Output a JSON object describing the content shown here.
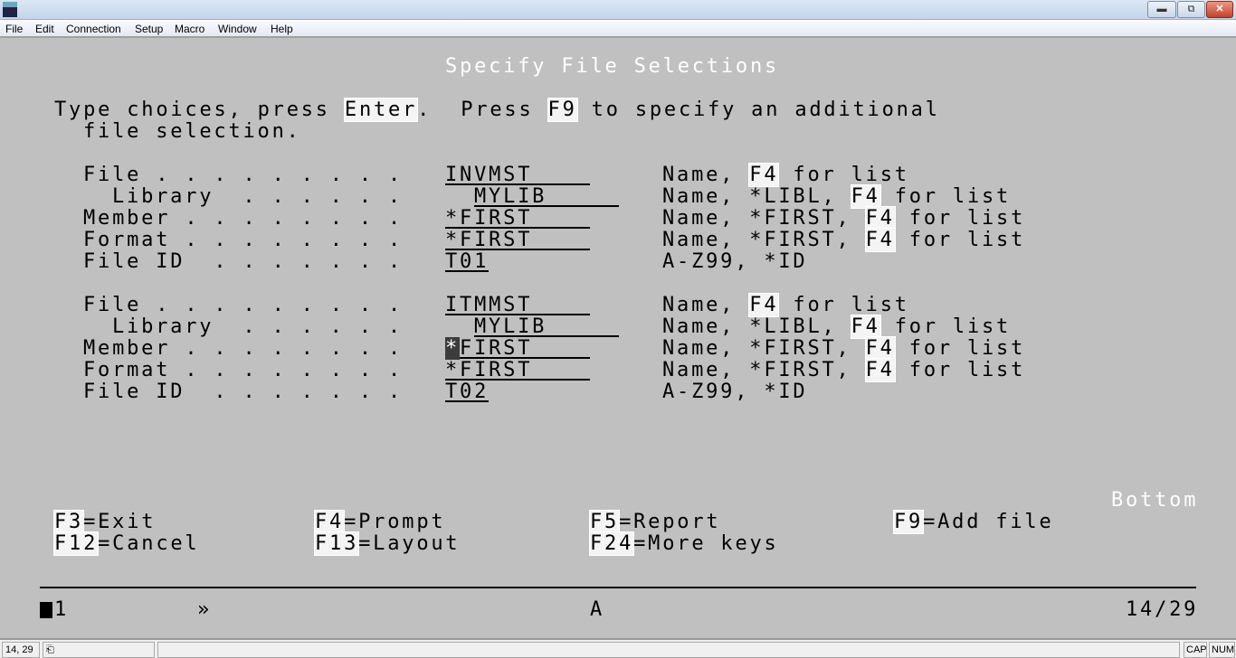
{
  "window": {
    "app_icon": "IBM",
    "controls": [
      "minimize",
      "restore",
      "close"
    ]
  },
  "menu": [
    "File",
    "Edit",
    "Connection",
    "Setup",
    "Macro",
    "Window",
    "Help"
  ],
  "screen": {
    "title": "Specify File Selections",
    "instructions": {
      "p1": "Type choices, press ",
      "k1": "Enter",
      "p2": ".  Press ",
      "k2": "F9",
      "p3": " to specify an additional",
      "line2": "file selection."
    },
    "groups": [
      {
        "file": "INVMST",
        "library": "MYLIB",
        "member": "*FIRST",
        "format": "*FIRST",
        "file_id": "T01"
      },
      {
        "file": "ITMMST",
        "library": "MYLIB",
        "member_cursor": "*",
        "member_rest": "FIRST",
        "format": "*FIRST",
        "file_id": "T02"
      }
    ],
    "labels": {
      "file": "File . . . . . . . . .",
      "library": "Library  . . . . . .",
      "member": "Member . . . . . . . .",
      "format": "Format . . . . . . . .",
      "file_id": "File ID  . . . . . . ."
    },
    "help": {
      "name": "Name, ",
      "name_lib": "Name, *LIBL, ",
      "name_first": "Name, *FIRST, ",
      "f4": "F4",
      "for_list": " for list",
      "file_id": "A-Z99, *ID"
    },
    "more": "Bottom",
    "fkeys": [
      {
        "key": "F3",
        "label": "=Exit"
      },
      {
        "key": "F4",
        "label": "=Prompt"
      },
      {
        "key": "F5",
        "label": "=Report"
      },
      {
        "key": "F9",
        "label": "=Add file"
      },
      {
        "key": "F12",
        "label": "=Cancel"
      },
      {
        "key": "F13",
        "label": "=Layout"
      },
      {
        "key": "F24",
        "label": "=More keys"
      }
    ],
    "oia": {
      "session": "1",
      "indicator": "»",
      "mode": "A",
      "cursor_pos": "14/29"
    }
  },
  "statusbar": {
    "position": "14, 29",
    "cap": "CAP",
    "num": "NUM"
  }
}
